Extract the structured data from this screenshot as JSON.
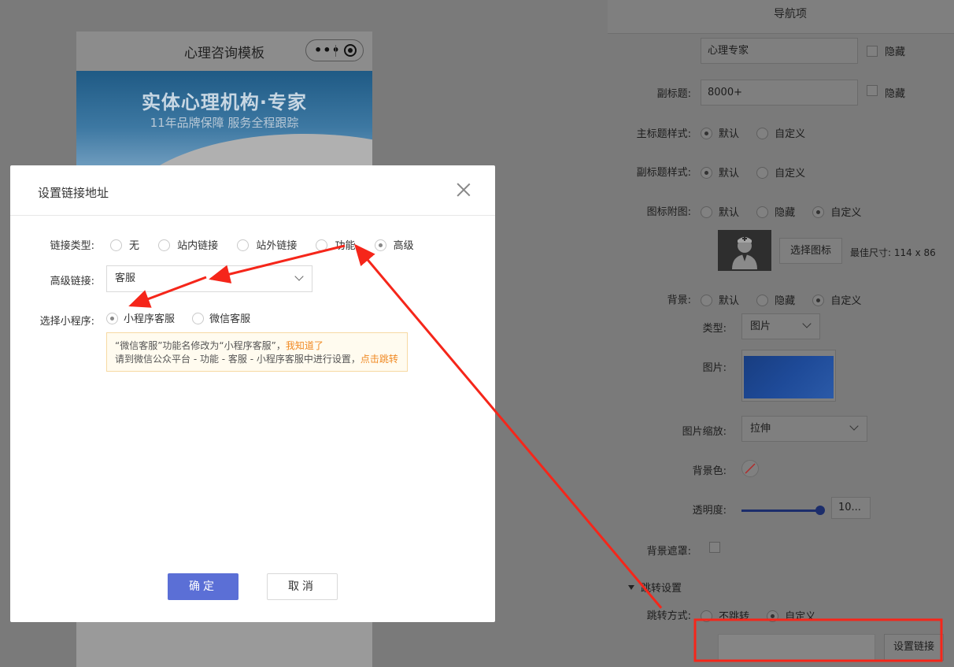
{
  "preview": {
    "page_title": "心理咨询模板",
    "capsule_dots": "•••",
    "banner_title": "实体心理机构·专家",
    "banner_subtitle": "11年品牌保障   服务全程跟踪"
  },
  "panel": {
    "title": "导航项",
    "main_title_value": "心理专家",
    "main_title_hide_label": "隐藏",
    "subtitle_label": "副标题:",
    "subtitle_value": "8000+",
    "subtitle_hide_label": "隐藏",
    "main_title_style_label": "主标题样式:",
    "subtitle_style_label": "副标题样式:",
    "icon_image_label": "图标附图:",
    "opt_default": "默认",
    "opt_custom": "自定义",
    "opt_hide": "隐藏",
    "select_icon_button": "选择图标",
    "best_size_text": "最佳尺寸: 114 x 86",
    "background_label": "背景:",
    "type_label": "类型:",
    "type_value": "图片",
    "image_label": "图片:",
    "image_scale_label": "图片缩放:",
    "image_scale_value": "拉伸",
    "bg_color_label": "背景色:",
    "opacity_label": "透明度:",
    "opacity_value": "10...",
    "bg_mask_label": "背景遮罩:",
    "jump_section_title": "跳转设置",
    "jump_mode_label": "跳转方式:",
    "jump_no": "不跳转",
    "jump_custom": "自定义",
    "set_link_button": "设置链接"
  },
  "modal": {
    "title": "设置链接地址",
    "link_type_label": "链接类型:",
    "link_types": [
      "无",
      "站内链接",
      "站外链接",
      "功能",
      "高级"
    ],
    "selected_link_type": "高级",
    "advanced_link_label": "高级链接:",
    "advanced_link_value": "客服",
    "mini_program_label": "选择小程序:",
    "mini_program_options": [
      "小程序客服",
      "微信客服"
    ],
    "notice_line1": "“微信客服”功能名修改为“小程序客服”，",
    "notice_link1": "我知道了",
    "notice_line2": "请到微信公众平台 - 功能 - 客服 - 小程序客服中进行设置，",
    "notice_link2": "点击跳转",
    "ok_button": "确定",
    "cancel_button": "取消"
  },
  "colors": {
    "annotation_red": "#f5261a",
    "primary_button": "#5b6fd6",
    "notice_link": "#f08a24"
  }
}
